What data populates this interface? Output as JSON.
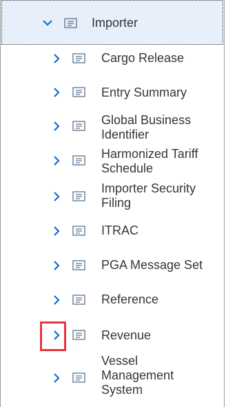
{
  "tree": {
    "root": {
      "label": "Importer",
      "expanded": true,
      "icon": "folder-node-icon"
    },
    "children": [
      {
        "label": "Cargo Release"
      },
      {
        "label": "Entry Summary"
      },
      {
        "label": "Global Business\nIdentifier"
      },
      {
        "label": "Harmonized Tariff\nSchedule"
      },
      {
        "label": "Importer Security\nFiling"
      },
      {
        "label": "ITRAC"
      },
      {
        "label": "PGA Message Set"
      },
      {
        "label": "Reference"
      },
      {
        "label": "Revenue"
      },
      {
        "label": "Vessel\nManagement\nSystem"
      }
    ]
  },
  "colors": {
    "accent": "#0a6ed1",
    "selected_bg": "#e6effa",
    "highlight_box": "#e8343a"
  }
}
